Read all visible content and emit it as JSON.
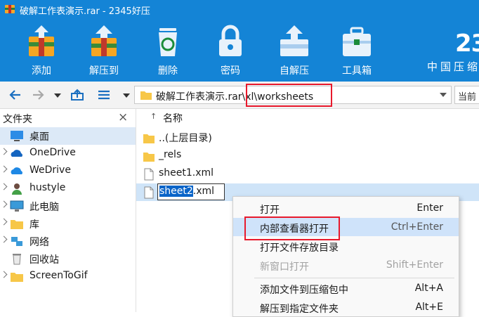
{
  "window": {
    "title": "破解工作表演示.rar - 2345好压"
  },
  "toolbar": {
    "items": [
      {
        "label": "添加",
        "icon": "archive-add-icon"
      },
      {
        "label": "解压到",
        "icon": "extract-icon"
      },
      {
        "label": "删除",
        "icon": "recycle-bin-icon"
      },
      {
        "label": "密码",
        "icon": "lock-icon"
      },
      {
        "label": "自解压",
        "icon": "self-extract-icon"
      },
      {
        "label": "工具箱",
        "icon": "toolbox-icon"
      }
    ],
    "brand_number": "23",
    "brand_text": "中国压缩"
  },
  "nav": {
    "address": "破解工作表演示.rar\\xl\\worksheets",
    "current_label": "当前"
  },
  "left_pane": {
    "header": "文件夹",
    "close_glyph": "×",
    "items": [
      {
        "label": "桌面",
        "icon": "desktop-icon",
        "selected": true
      },
      {
        "label": "OneDrive",
        "icon": "onedrive-icon"
      },
      {
        "label": "WeDrive",
        "icon": "wedrive-icon"
      },
      {
        "label": "hustyle",
        "icon": "user-icon"
      },
      {
        "label": "此电脑",
        "icon": "computer-icon"
      },
      {
        "label": "库",
        "icon": "library-icon"
      },
      {
        "label": "网络",
        "icon": "network-icon"
      },
      {
        "label": "回收站",
        "icon": "recycle-bin-icon"
      },
      {
        "label": "ScreenToGif",
        "icon": "folder-icon"
      }
    ]
  },
  "file_list": {
    "column_header": "名称",
    "sort_glyph": "↑",
    "items": [
      {
        "label": "..(上层目录)",
        "icon": "folder-icon"
      },
      {
        "label": "_rels",
        "icon": "folder-icon"
      },
      {
        "label": "sheet1.xml",
        "icon": "file-icon"
      }
    ],
    "renaming": {
      "selected_part": "sheet2",
      "rest": ".xml"
    }
  },
  "context_menu": {
    "items": [
      {
        "label": "打开",
        "shortcut": "Enter"
      },
      {
        "label": "内部查看器打开",
        "shortcut": "Ctrl+Enter",
        "hover": true
      },
      {
        "label": "打开文件存放目录",
        "shortcut": ""
      },
      {
        "label": "新窗口打开",
        "shortcut": "Shift+Enter",
        "disabled": true
      },
      {
        "label": "添加文件到压缩包中",
        "shortcut": "Alt+A"
      },
      {
        "label": "解压到指定文件夹",
        "shortcut": "Alt+E"
      }
    ]
  },
  "colors": {
    "toolbar_bg": "#1484d6",
    "highlight_box": "#e8192c",
    "selection": "#0a64c8"
  }
}
